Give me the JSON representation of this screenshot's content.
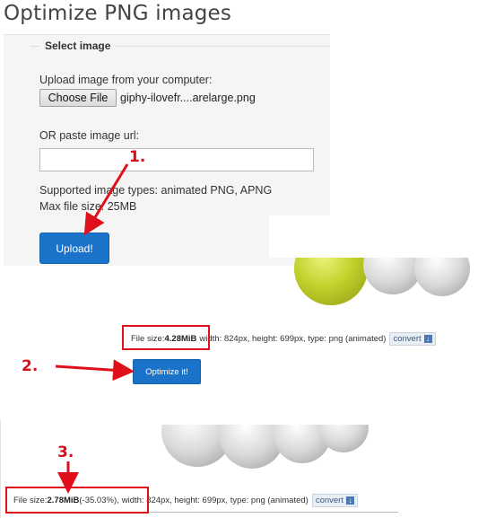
{
  "page": {
    "title": "Optimize PNG images"
  },
  "select_image": {
    "legend": "Select image",
    "upload_label": "Upload image from your computer:",
    "choose_file_label": "Choose File",
    "filename": "giphy-ilovefr....arelarge.png",
    "url_label": "OR paste image url:",
    "url_value": "",
    "supported_types": "Supported image types: animated PNG, APNG",
    "max_size": "Max file size: 25MB",
    "upload_button": "Upload!"
  },
  "result_before": {
    "file_size_label": "File size: ",
    "file_size_value": "4.28MiB",
    "details": "width: 824px, height: 699px, type: png (animated)",
    "convert_label": "convert",
    "optimize_button": "Optimize it!"
  },
  "result_after": {
    "file_size_label": "File size: ",
    "file_size_value": "2.78MiB",
    "reduction": " (-35.03%),",
    "details": "width: 824px, height: 699px, type: png (animated)",
    "convert_label": "convert"
  },
  "annotations": {
    "step1": "1.",
    "step2": "2.",
    "step3": "3.",
    "color": "#e0101a"
  },
  "colors": {
    "primary_button": "#1a73c9",
    "panel_background": "#f5f5f5",
    "sphere_green": "#c3d12c",
    "sphere_gray": "#d9d9d9"
  },
  "icons": {
    "convert_download": "download-icon"
  }
}
